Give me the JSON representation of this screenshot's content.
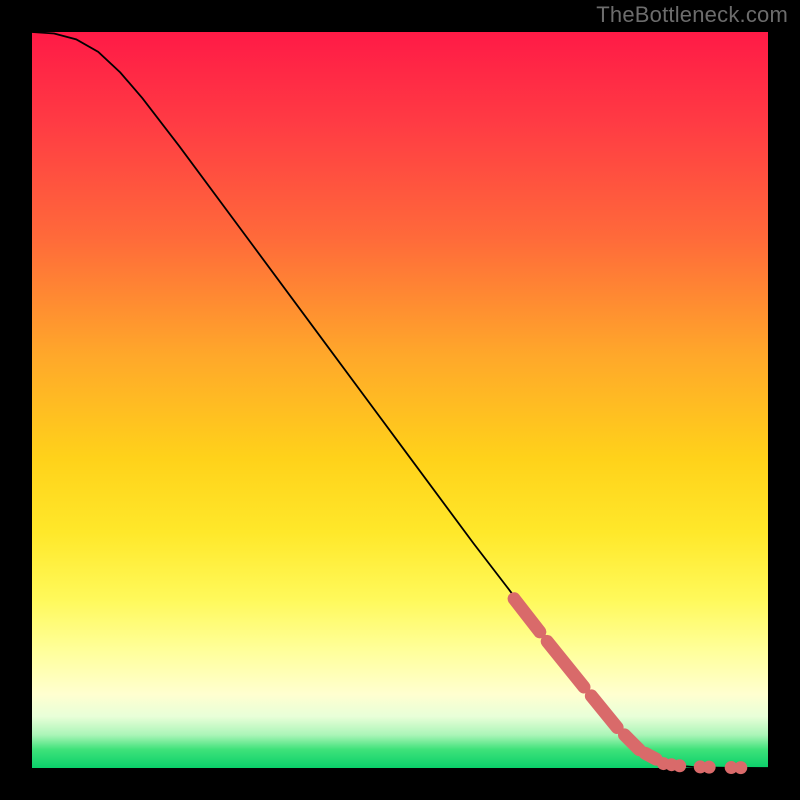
{
  "watermark": "TheBottleneck.com",
  "colors": {
    "dot": "#d96a6a",
    "curve": "#000000"
  },
  "chart_data": {
    "type": "line",
    "title": "",
    "xlabel": "",
    "ylabel": "",
    "xlim": [
      0,
      100
    ],
    "ylim": [
      0,
      100
    ],
    "grid": false,
    "curve_points": [
      {
        "x": 0.0,
        "y": 100.0
      },
      {
        "x": 3.0,
        "y": 99.8
      },
      {
        "x": 6.0,
        "y": 99.0
      },
      {
        "x": 9.0,
        "y": 97.3
      },
      {
        "x": 12.0,
        "y": 94.5
      },
      {
        "x": 15.0,
        "y": 91.0
      },
      {
        "x": 20.0,
        "y": 84.5
      },
      {
        "x": 30.0,
        "y": 71.0
      },
      {
        "x": 40.0,
        "y": 57.5
      },
      {
        "x": 50.0,
        "y": 44.0
      },
      {
        "x": 60.0,
        "y": 30.5
      },
      {
        "x": 65.0,
        "y": 24.0
      },
      {
        "x": 70.0,
        "y": 17.5
      },
      {
        "x": 75.0,
        "y": 11.0
      },
      {
        "x": 78.0,
        "y": 7.2
      },
      {
        "x": 81.0,
        "y": 4.0
      },
      {
        "x": 83.5,
        "y": 2.0
      },
      {
        "x": 86.0,
        "y": 0.8
      },
      {
        "x": 88.0,
        "y": 0.3
      },
      {
        "x": 90.0,
        "y": 0.12
      },
      {
        "x": 93.0,
        "y": 0.05
      },
      {
        "x": 96.0,
        "y": 0.02
      },
      {
        "x": 100.0,
        "y": 0.0
      }
    ],
    "dot_segments": [
      {
        "x0": 65.5,
        "y0": 23.0,
        "x1": 69.0,
        "y1": 18.5
      },
      {
        "x0": 70.0,
        "y0": 17.2,
        "x1": 75.0,
        "y1": 11.0
      },
      {
        "x0": 76.0,
        "y0": 9.8,
        "x1": 79.5,
        "y1": 5.5
      },
      {
        "x0": 80.5,
        "y0": 4.5,
        "x1": 82.5,
        "y1": 2.5
      },
      {
        "x0": 83.3,
        "y0": 2.0,
        "x1": 84.8,
        "y1": 1.2
      }
    ],
    "dot_points": [
      {
        "x": 85.8,
        "y": 0.6
      },
      {
        "x": 86.9,
        "y": 0.45
      },
      {
        "x": 88.0,
        "y": 0.3
      },
      {
        "x": 90.8,
        "y": 0.15
      },
      {
        "x": 92.0,
        "y": 0.12
      },
      {
        "x": 95.0,
        "y": 0.06
      },
      {
        "x": 96.3,
        "y": 0.05
      }
    ]
  }
}
